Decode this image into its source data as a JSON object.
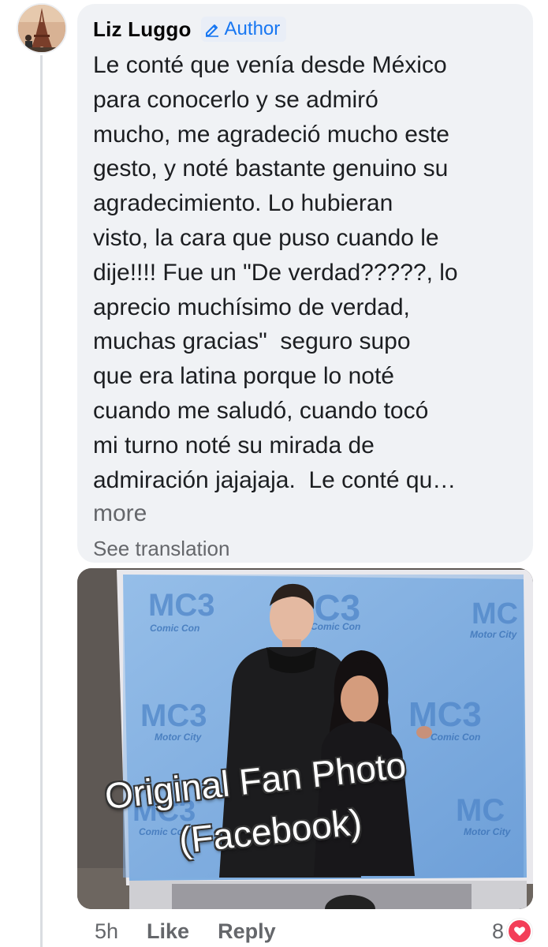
{
  "comment": {
    "author": "Liz Luggo",
    "badge": "Author",
    "text": "Le conté que venía desde México\npara conocerlo y se admiró\nmucho, me agradeció mucho este\ngesto, y noté bastante genuino su\nagradecimiento. Lo hubieran\nvisto, la cara que puso cuando le\ndije!!!! Fue un \"De verdad?????, lo\naprecio muchísimo de verdad,\nmuchas gracias\"  seguro supo\nque era latina porque lo noté\ncuando me saludó, cuando tocó\nmi turno noté su mirada de\nadmiración jajajaja.  Le conté qu…",
    "more_label": "more",
    "translation_label": "See translation"
  },
  "photo": {
    "caption_line1": "Original Fan Photo",
    "caption_line2": "(Facebook)",
    "backdrop_text": {
      "comic_con": "Comic Con",
      "motor_city": "Motor City",
      "mc3": "MC3"
    }
  },
  "actions": {
    "time": "5h",
    "like_label": "Like",
    "reply_label": "Reply",
    "reaction_count": "8"
  },
  "colors": {
    "bubble_bg": "#f0f2f5",
    "link_blue": "#1877f2",
    "meta_gray": "#65676b",
    "heart_red": "#f33e58"
  },
  "icons": {
    "badge_icon": "pencil-icon",
    "reaction_icon": "heart-icon"
  }
}
